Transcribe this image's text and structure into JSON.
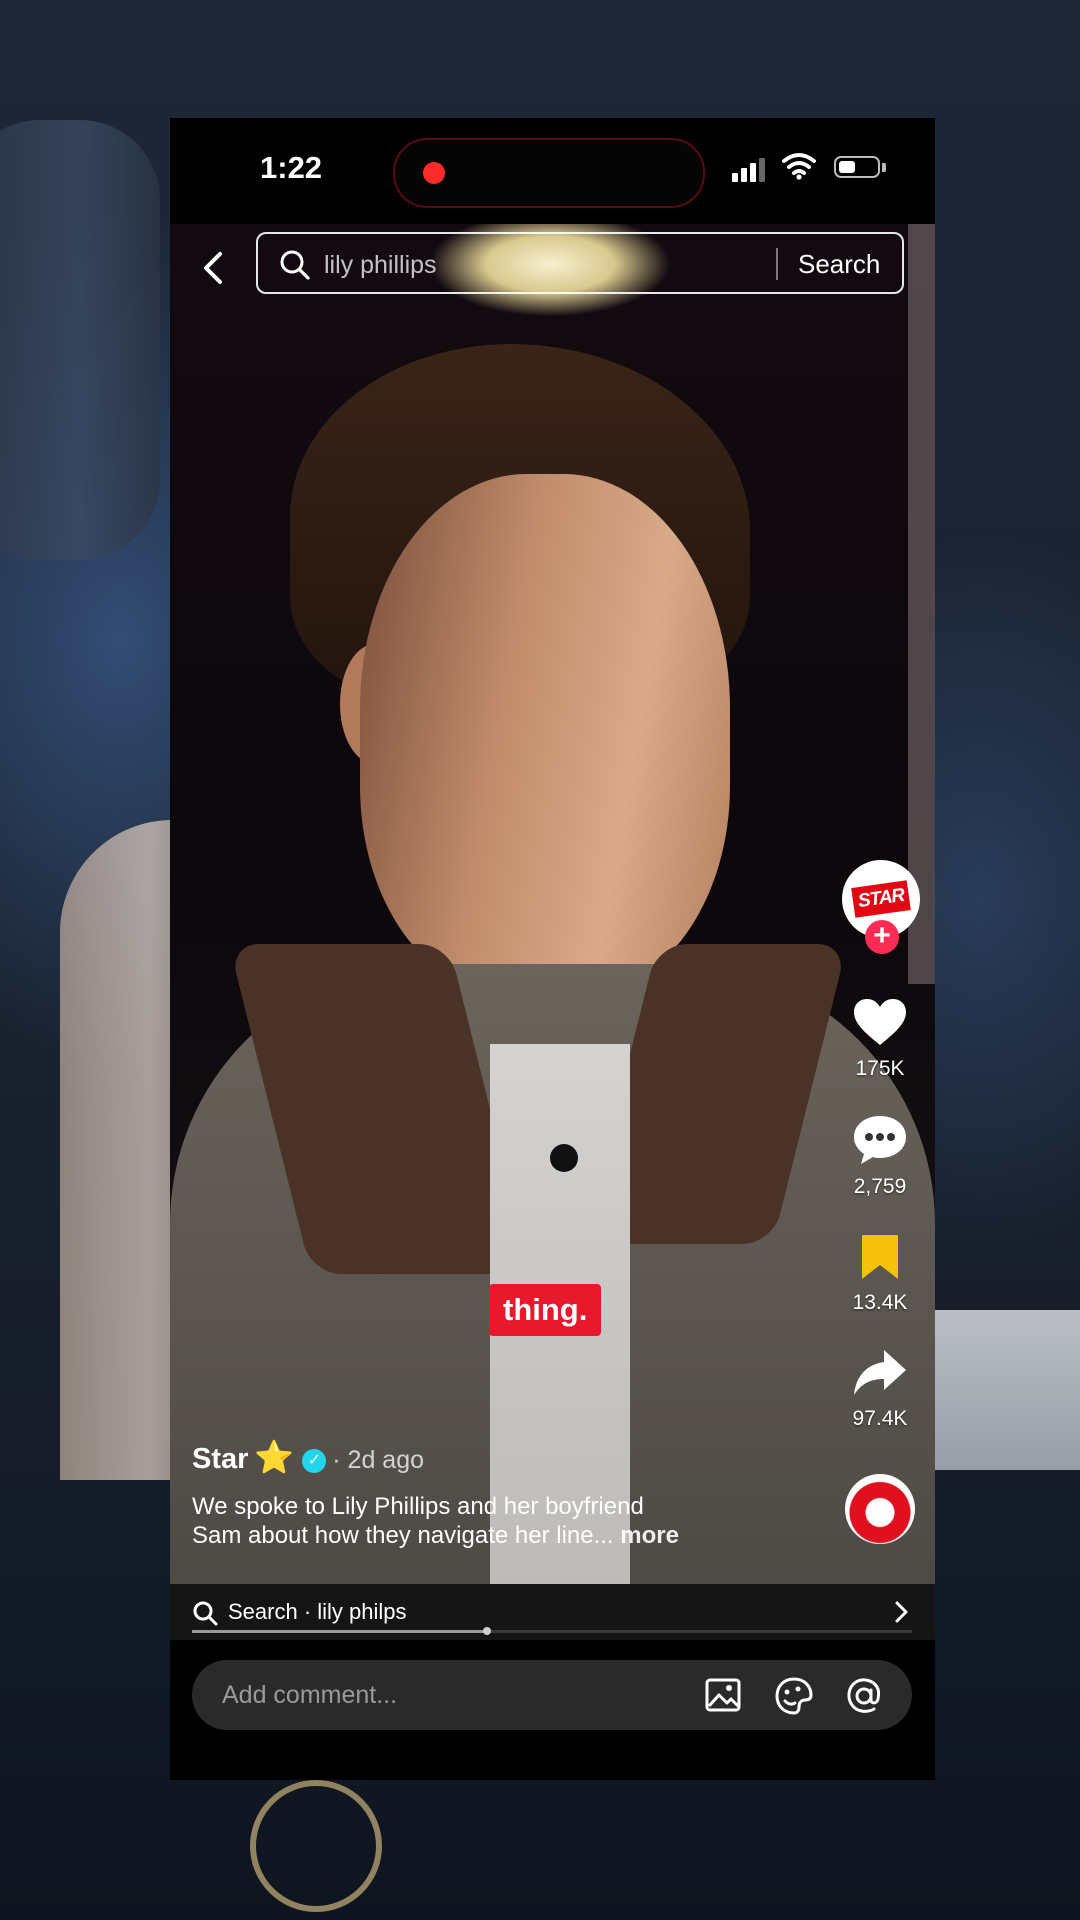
{
  "status_bar": {
    "time": "1:22"
  },
  "search": {
    "query": "lily phillips",
    "button_label": "Search"
  },
  "video": {
    "subtitle": "thing."
  },
  "creator": {
    "avatar_text": "STAR",
    "name": "Star",
    "emoji": "⭐",
    "posted": "· 2d ago"
  },
  "actions": {
    "likes": "175K",
    "comments": "2,759",
    "saves": "13.4K",
    "shares": "97.4K"
  },
  "caption": {
    "line1": "We spoke to Lily Phillips and her boyfriend",
    "line2": "Sam about how they navigate her line...",
    "more": "more"
  },
  "related_search": {
    "text": "Search · lily philps"
  },
  "progress": {
    "fraction": 0.41
  },
  "comment_bar": {
    "placeholder": "Add comment..."
  },
  "colors": {
    "accent": "#fe2c55",
    "save": "#f6c10b",
    "verified": "#20d5ec",
    "subtitle_bg": "#e8192c"
  },
  "icons": [
    "back-icon",
    "search-icon",
    "heart-icon",
    "comment-icon",
    "bookmark-icon",
    "share-icon",
    "music-disc-icon",
    "image-icon",
    "emoji-icon",
    "mention-icon",
    "chevron-right-icon"
  ]
}
